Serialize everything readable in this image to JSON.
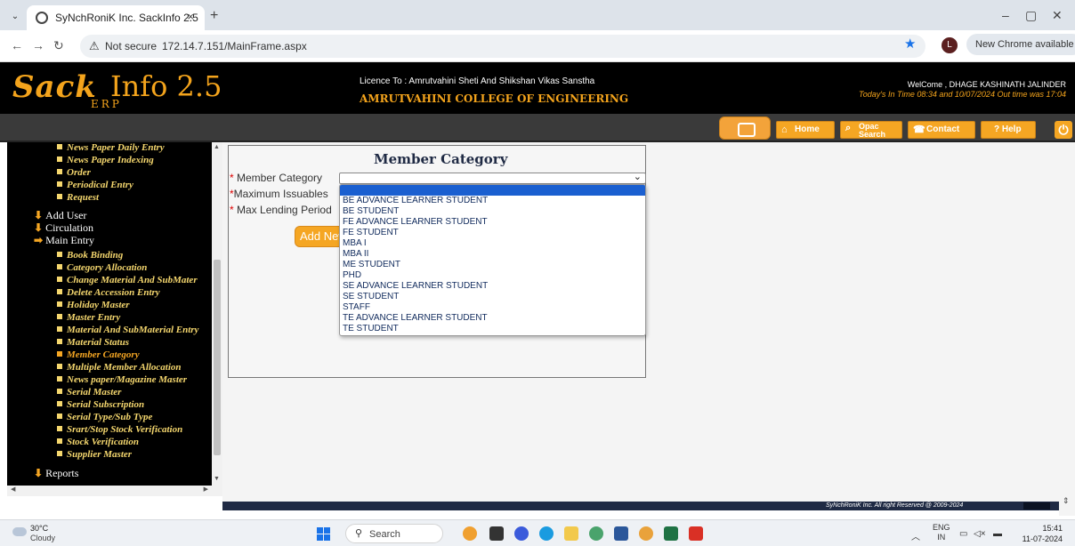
{
  "browser": {
    "tab_title": "SyNchRoniK Inc. SackInfo 2.5",
    "tab_close": "×",
    "new_tab": "+",
    "not_secure": "Not secure",
    "url": "172.14.7.151/MainFrame.aspx",
    "profile_initial": "L",
    "new_chrome": "New Chrome available",
    "icons": [
      "dropdown-icon",
      "globe-icon",
      "back-icon",
      "forward-icon",
      "reload-icon",
      "warning-icon",
      "star-icon",
      "minimize-icon",
      "restore-icon",
      "close-icon"
    ]
  },
  "header": {
    "logo_word1": "Sack",
    "logo_word2": "Info",
    "logo_version": "2.5",
    "logo_sub": "ERP",
    "licence": "Licence To : Amrutvahini Sheti And Shikshan Vikas Sanstha",
    "college": "AMRUTVAHINI COLLEGE OF ENGINEERING",
    "welcome": "WelCome , DHAGE KASHINATH JALINDER",
    "time_info": "Today's In Time 08:34 and 10/07/2024 Out time was 17:04"
  },
  "menubar": {
    "home": "Home",
    "opac_line1": "Opac",
    "opac_line2": "Search",
    "contact": "Contact",
    "help": "? Help"
  },
  "sidebar": {
    "top_items": [
      "News Paper Daily Entry",
      "News Paper Indexing",
      "Order",
      "Periodical Entry",
      "Request"
    ],
    "heads": [
      "Add User",
      "Circulation",
      "Main Entry"
    ],
    "main_entry_items": [
      "Book Binding",
      "Category Allocation",
      "Change Material And SubMater",
      "Delete Accession Entry",
      "Holiday Master",
      "Master Entry",
      "Material And SubMaterial Entry",
      "Material Status",
      "Member Category",
      "Multiple Member Allocation",
      "News paper/Magazine Master",
      "Serial Master",
      "Serial Subscription",
      "Serial Type/Sub Type",
      "Srart/Stop Stock Verification",
      "Stock Verification",
      "Supplier Master"
    ],
    "reports": "Reports",
    "active_item": "Member Category"
  },
  "form": {
    "title": "Member Category",
    "label_category": "Member Category",
    "label_issuables": "Maximum Issuables",
    "label_lending": "Max Lending Period",
    "required_mark": "*",
    "add_button": "Add New",
    "selected_value": "",
    "options": [
      "",
      "BE ADVANCE LEARNER STUDENT",
      "BE STUDENT",
      "FE ADVANCE LEARNER STUDENT",
      "FE STUDENT",
      "MBA I",
      "MBA II",
      "ME STUDENT",
      "PHD",
      "SE ADVANCE LEARNER STUDENT",
      "SE STUDENT",
      "STAFF",
      "TE ADVANCE LEARNER STUDENT",
      "TE STUDENT"
    ]
  },
  "footer": {
    "copyright": "SyNchRoniK Inc. All right Reserved @ 2009-2024"
  },
  "taskbar": {
    "temperature": "30°C",
    "weather": "Cloudy",
    "search": "Search",
    "lang1": "ENG",
    "lang2": "IN",
    "time": "15:41",
    "date": "11-07-2024"
  },
  "colors": {
    "accent_orange": "#f5a623",
    "header_bg": "#000000",
    "selected_option": "#1a5fd0",
    "sidebar_text": "#f5d76e"
  }
}
